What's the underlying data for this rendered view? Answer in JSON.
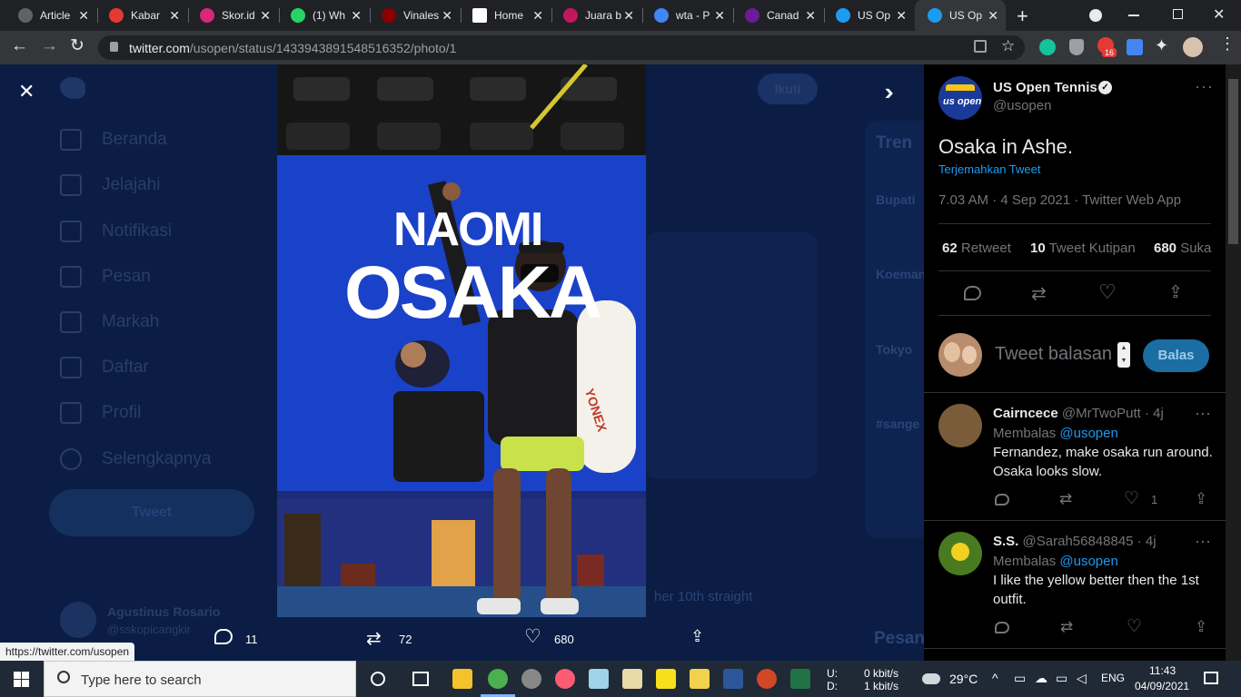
{
  "tabs": [
    {
      "label": "Article",
      "color": "#5f6368"
    },
    {
      "label": "Kabar",
      "color": "#e53935"
    },
    {
      "label": "Skor.id",
      "color": "#d62976"
    },
    {
      "label": "(1) Wh",
      "color": "#25d366"
    },
    {
      "label": "Vinales",
      "color": "#8b0000"
    },
    {
      "label": "Home",
      "color": "#ffffff"
    },
    {
      "label": "Juara b",
      "color": "#c2185b"
    },
    {
      "label": "wta - P",
      "color": "#4285f4"
    },
    {
      "label": "Canad",
      "color": "#6a1b9a"
    },
    {
      "label": "US Op",
      "color": "#1d9bf0"
    },
    {
      "label": "US Op",
      "color": "#1d9bf0"
    }
  ],
  "address_bar": {
    "host": "twitter.com",
    "path": "/usopen/status/1433943891548516352/photo/1",
    "extension_badge": "16"
  },
  "background_sidebar": {
    "items": [
      "Beranda",
      "Jelajahi",
      "Notifikasi",
      "Pesan",
      "Markah",
      "Daftar",
      "Profil",
      "Selengkapnya"
    ],
    "tweet_button": "Tweet",
    "user_name": "Agustinus Rosario",
    "user_handle": "@sskopicangkir"
  },
  "background_right": {
    "trends_title": "Tren",
    "trends": [
      "Bupati",
      "Koeman",
      "Tokyo",
      "#sange"
    ],
    "follow_button": "Ikuti",
    "messages_label": "Pesan",
    "snippet": "her 10th straight"
  },
  "photo": {
    "alt_text_top": "NAOMI",
    "alt_text_bottom": "OSAKA",
    "racket_brand": "YONEX"
  },
  "photo_actions": {
    "replies": "11",
    "retweets": "72",
    "likes": "680"
  },
  "status_url": "https://twitter.com/usopen",
  "tweet": {
    "author_name": "US Open Tennis",
    "author_handle": "@usopen",
    "avatar_text": "us open",
    "text": "Osaka in Ashe.",
    "translate": "Terjemahkan Tweet",
    "meta": "7.03 AM · 4 Sep 2021 · Twitter Web App",
    "retweet_count": "62",
    "retweet_label": "Retweet",
    "quote_count": "10",
    "quote_label": "Tweet Kutipan",
    "like_count": "680",
    "like_label": "Suka",
    "reply_placeholder": "Tweet balasan",
    "reply_button": "Balas"
  },
  "replies": [
    {
      "name": "Cairncece",
      "handle": "@MrTwoPutt",
      "time": "· 4j",
      "replying_label": "Membalas",
      "replying_to": "@usopen",
      "text_line1": "Fernandez, make osaka run around.",
      "text_line2": "Osaka looks slow.",
      "likes": "1"
    },
    {
      "name": "S.S.",
      "handle": "@Sarah56848845",
      "time": "· 4j",
      "replying_label": "Membalas",
      "replying_to": "@usopen",
      "text_line1": "I like the yellow better then the 1st",
      "text_line2": "outfit.",
      "likes": ""
    }
  ],
  "taskbar": {
    "search_placeholder": "Type here to search",
    "net_up_label": "U:",
    "net_down_label": "D:",
    "net_up": "0 kbit/s",
    "net_down": "1 kbit/s",
    "temperature": "29°C",
    "language": "ENG",
    "time": "11:43",
    "date": "04/09/2021"
  }
}
